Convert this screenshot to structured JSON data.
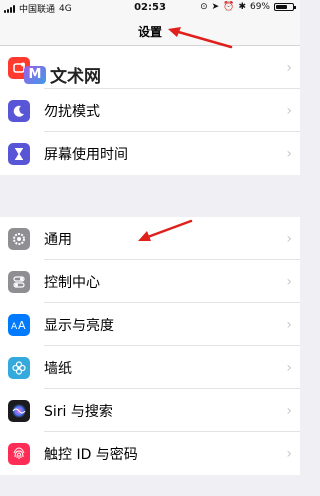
{
  "status_bar": {
    "carrier": "中国联通",
    "network": "4G",
    "time": "02:53",
    "battery_percent": "69%",
    "battery_level": 0.69
  },
  "nav": {
    "title": "设置"
  },
  "watermark": {
    "text": "文术网"
  },
  "groups": [
    {
      "items": [
        {
          "label": "",
          "icon": "notifications-icon",
          "color": "#ff3b30"
        },
        {
          "label": "勿扰模式",
          "icon": "moon-icon",
          "color": "#5856d6"
        },
        {
          "label": "屏幕使用时间",
          "icon": "hourglass-icon",
          "color": "#5856d6"
        }
      ]
    },
    {
      "items": [
        {
          "label": "通用",
          "icon": "gear-icon",
          "color": "#8e8e93"
        },
        {
          "label": "控制中心",
          "icon": "toggles-icon",
          "color": "#8e8e93"
        },
        {
          "label": "显示与亮度",
          "icon": "text-size-icon",
          "color": "#007aff"
        },
        {
          "label": "墙纸",
          "icon": "flower-icon",
          "color": "#34aadc"
        },
        {
          "label": "Siri 与搜索",
          "icon": "siri-icon",
          "color": "#1c1c1e"
        },
        {
          "label": "触控 ID 与密码",
          "icon": "fingerprint-icon",
          "color": "#ff2d55"
        }
      ]
    }
  ]
}
